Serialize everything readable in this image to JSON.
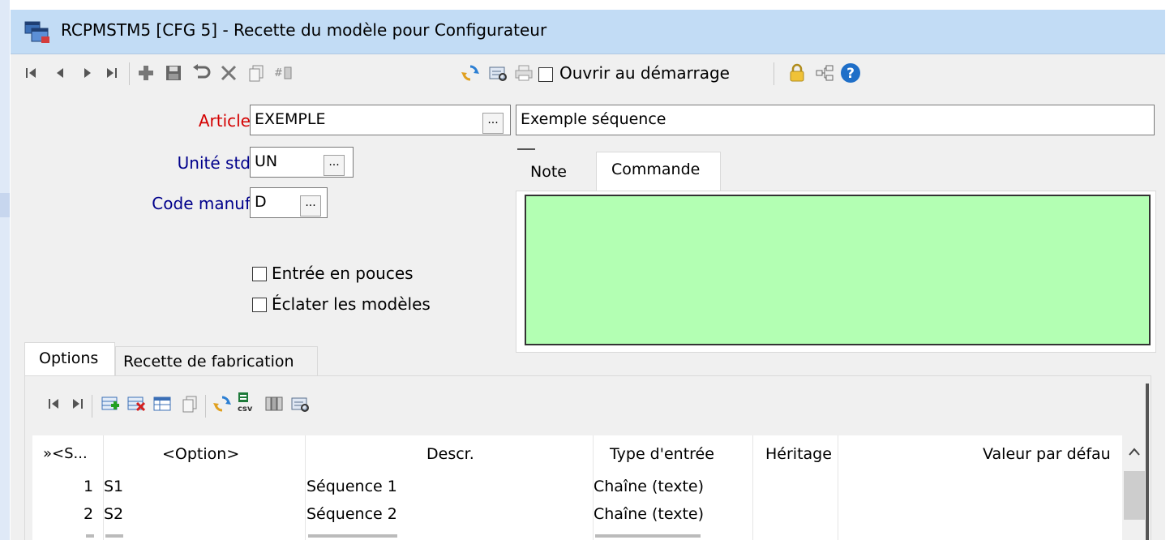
{
  "window": {
    "title": "RCPMSTM5 [CFG 5] - Recette du modèle pour Configurateur",
    "app_icon": "app-window-icon"
  },
  "toolbar": {
    "buttons": [
      "first-record-icon",
      "previous-record-icon",
      "next-record-icon",
      "last-record-icon",
      "add-icon",
      "save-icon",
      "undo-icon",
      "delete-icon",
      "copy-icon",
      "renumber-icon",
      "refresh-icon",
      "print-preview-icon",
      "print-icon"
    ],
    "open_at_start_label": "Ouvrir au démarrage",
    "open_at_start_checked": false,
    "right_icons": [
      "lock-icon",
      "tree-icon",
      "help-icon"
    ]
  },
  "form": {
    "article_label": "Article",
    "article_value": "EXEMPLE",
    "article_description": "Exemple séquence",
    "unit_label": "Unité std",
    "unit_value": "UN",
    "manuf_label": "Code manuf",
    "manuf_value": "D",
    "ellipsis": "...",
    "inches_label": "Entrée en pouces",
    "inches_checked": false,
    "explode_label": "Éclater les modèles",
    "explode_checked": false,
    "label_color_required": "#d40000",
    "label_color_link": "#00008b"
  },
  "notes_tabs": {
    "tabs": [
      "Note",
      "Commande"
    ],
    "active": "Commande",
    "area_color": "#b3ffb3"
  },
  "main_tabs": {
    "tabs": [
      "Options",
      "Recette de fabrication"
    ],
    "active": "Options"
  },
  "grid_toolbar": {
    "buttons": [
      "first-row-icon",
      "last-row-icon",
      "insert-row-icon",
      "delete-row-icon",
      "grid-view-icon",
      "copy-row-icon",
      "refresh-grid-icon",
      "export-csv-icon",
      "columns-icon",
      "print-grid-icon"
    ]
  },
  "grid": {
    "columns": [
      "»<S...",
      "<Option>",
      "Descr.",
      "Type d'entrée",
      "Héritage",
      "Valeur par défau"
    ],
    "rows": [
      {
        "seq": "1",
        "option": "S1",
        "descr": "Séquence 1",
        "type": "Chaîne (texte)",
        "heritage": "",
        "default": ""
      },
      {
        "seq": "2",
        "option": "S2",
        "descr": "Séquence 2",
        "type": "Chaîne (texte)",
        "heritage": "",
        "default": ""
      }
    ]
  }
}
